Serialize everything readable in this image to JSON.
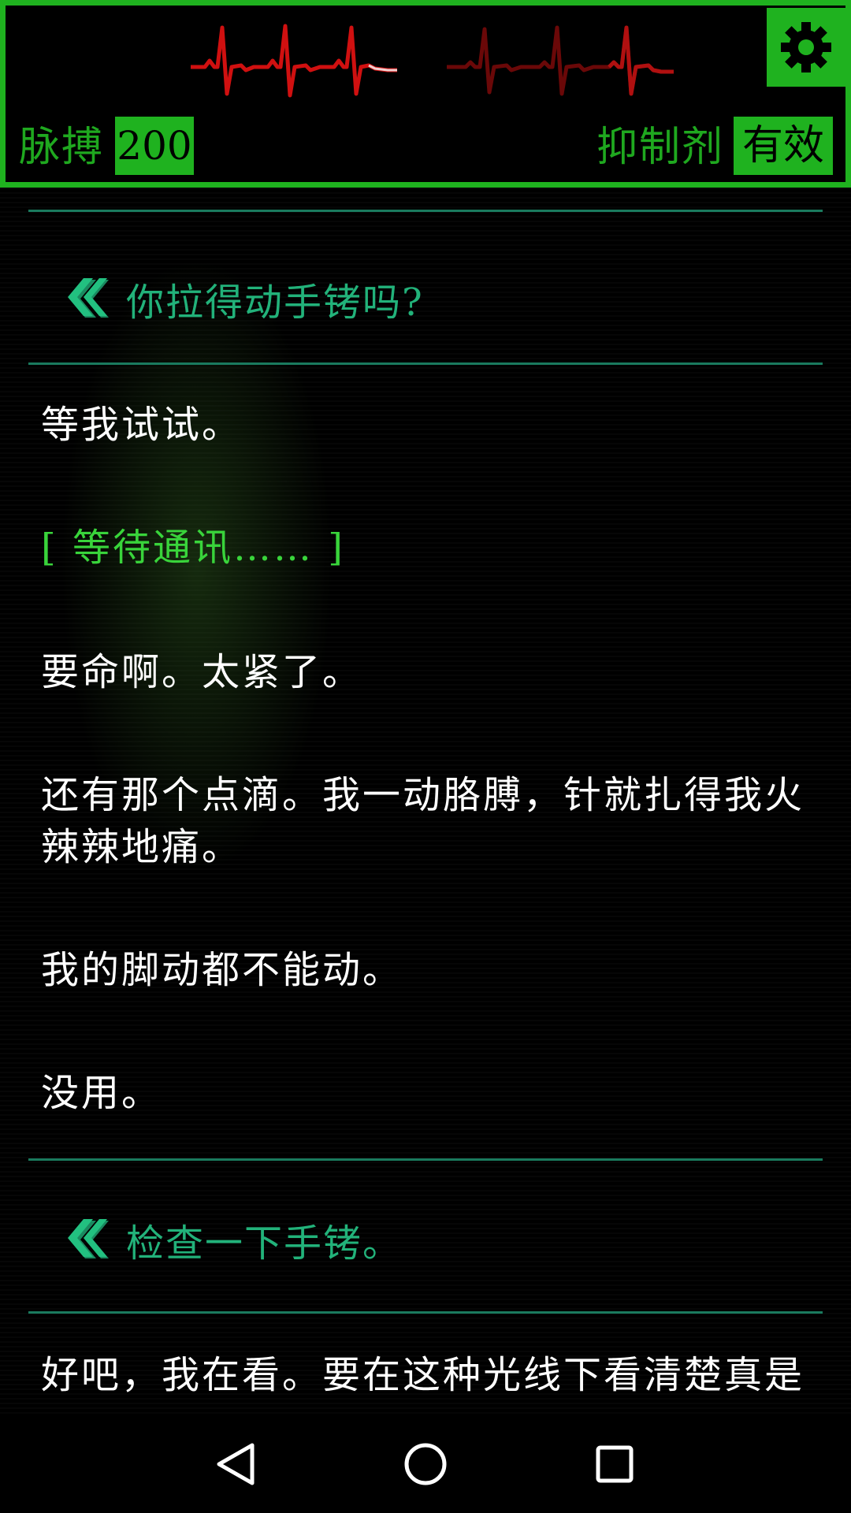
{
  "status": {
    "pulse_label": "脉搏",
    "pulse_value": "200",
    "inhibitor_label": "抑制剂",
    "inhibitor_value": "有效",
    "heartbeat_icon": "ecg-heartbeat-icon",
    "settings_icon": "gear-icon"
  },
  "colors": {
    "accent_green": "#1fb21f",
    "choice_teal": "#22b27a",
    "system_green": "#39d43b",
    "ecg_red": "#d01010",
    "divider": "#1a7a5e"
  },
  "conversation": {
    "choice_1": "你拉得动手铐吗?",
    "line_1": "等我试试。",
    "line_2": "[ 等待通讯…… ]",
    "line_3": "要命啊。太紧了。",
    "line_4a": "还有那个点滴。我一动胳膊，针就扎得我火",
    "line_4b": "辣辣地痛。",
    "line_5": "我的脚动都不能动。",
    "line_6": "没用。",
    "choice_2": "检查一下手铐。",
    "line_7": "好吧，我在看。要在这种光线下看清楚真是"
  },
  "navigation": {
    "back_icon": "back-triangle-icon",
    "home_icon": "home-circle-icon",
    "recents_icon": "recents-square-icon"
  }
}
